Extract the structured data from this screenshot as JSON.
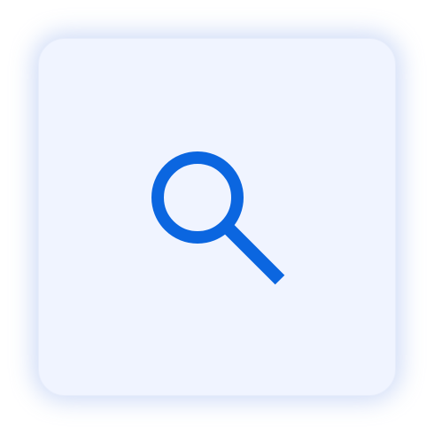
{
  "search_tile": {
    "icon": "search-icon",
    "background_color": "#f0f4ff",
    "icon_color": "#0b66e0"
  }
}
